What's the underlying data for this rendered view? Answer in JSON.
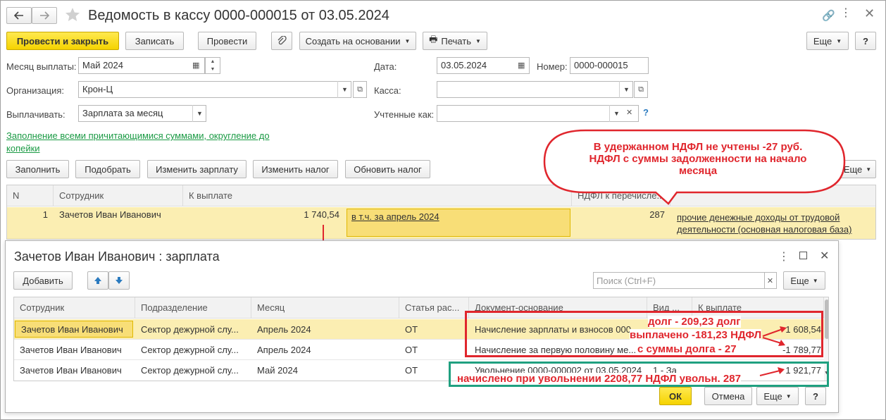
{
  "window": {
    "title": "Ведомость в кассу 0000-000015 от 03.05.2024"
  },
  "toolbar": {
    "post_close": "Провести и закрыть",
    "save": "Записать",
    "post": "Провести",
    "create_based": "Создать на основании",
    "print": "Печать",
    "more": "Еще",
    "help": "?"
  },
  "form": {
    "month_label": "Месяц выплаты:",
    "month_value": "Май 2024",
    "date_label": "Дата:",
    "date_value": "03.05.2024",
    "number_label": "Номер:",
    "number_value": "0000-000015",
    "org_label": "Организация:",
    "org_value": "Крон-Ц",
    "cash_label": "Касса:",
    "cash_value": "",
    "pay_label": "Выплачивать:",
    "pay_value": "Зарплата за месяц",
    "counted_label": "Учтенные как:",
    "counted_value": "",
    "fill_link": "Заполнение всеми причитающимися суммами, округление до копейки"
  },
  "actions": {
    "fill": "Заполнить",
    "pick": "Подобрать",
    "change_salary": "Изменить зарплату",
    "change_tax": "Изменить налог",
    "update_tax": "Обновить налог",
    "more": "Еще"
  },
  "main_table": {
    "headers": [
      "N",
      "Сотрудник",
      "К выплате",
      "НДФЛ к перечисле..."
    ],
    "rows": [
      {
        "n": "1",
        "employee": "Зачетов Иван Иванович",
        "amount": "1 740,54",
        "incl": "в т.ч. за апрель 2024",
        "ndfl": "287",
        "income_type": "прочие денежные доходы от трудовой деятельности (основная налоговая база)"
      }
    ]
  },
  "callout": {
    "text": "В удержанном НДФЛ не учтены -27 руб. НДФЛ с суммы задолженности на начало месяца"
  },
  "sub": {
    "title": "Зачетов Иван Иванович : зарплата",
    "add": "Добавить",
    "search_placeholder": "Поиск (Ctrl+F)",
    "more": "Еще",
    "headers": [
      "Сотрудник",
      "Подразделение",
      "Месяц",
      "Статья рас...",
      "Документ-основание",
      "Вид ...",
      "К выплате"
    ],
    "rows": [
      {
        "employee": "Зачетов Иван Иванович",
        "dept": "Сектор дежурной слу...",
        "month": "Апрель 2024",
        "article": "ОТ",
        "doc": "Начисление зарплаты и взносов 000",
        "kind": "",
        "amount": "1 608,54"
      },
      {
        "employee": "Зачетов Иван Иванович",
        "dept": "Сектор дежурной слу...",
        "month": "Апрель 2024",
        "article": "ОТ",
        "doc": "Начисление за первую половину ме...",
        "kind": "",
        "amount": "-1 789,77"
      },
      {
        "employee": "Зачетов Иван Иванович",
        "dept": "Сектор дежурной слу...",
        "month": "Май 2024",
        "article": "ОТ",
        "doc": "Увольнение 0000-000002 от 03.05.2024",
        "kind": "1 - За",
        "amount": "1 921,77"
      }
    ],
    "ok": "ОК",
    "cancel": "Отмена",
    "help": "?"
  },
  "annotations": {
    "debt_line1": "долг - 209,23 долг",
    "debt_line2": "выплачено -181,23 НДФЛ",
    "debt_line3": "с суммы долга - 27",
    "dismissal": "начислено при увольнении 2208,77 НДФЛ увольн. 287"
  },
  "colors": {
    "accent_yellow": "#f5d300",
    "highlight_row": "#fbeeb2",
    "annotation_red": "#e0262d",
    "annotation_green": "#20a080"
  }
}
